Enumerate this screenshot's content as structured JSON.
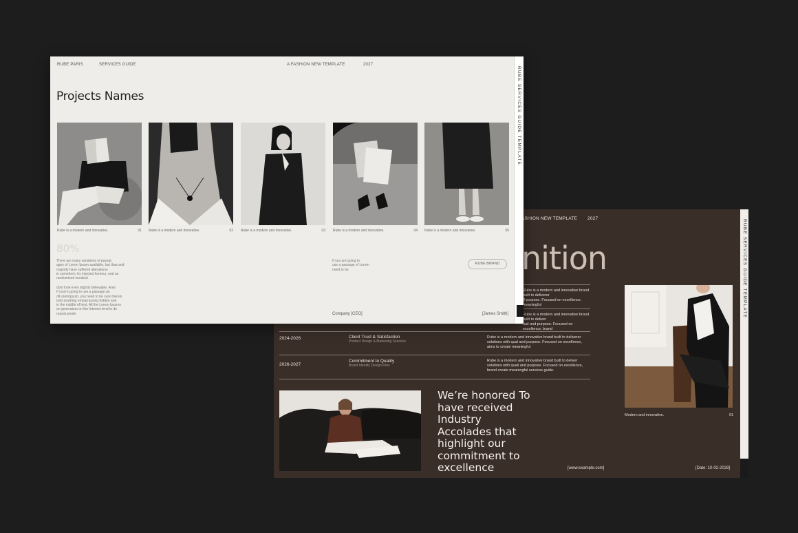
{
  "back_slide": {
    "header_left": "FASHION NEW TEMPLATE",
    "header_year": "2027",
    "big_word": "nition",
    "vertical_label": "RUBE SERVICES GUIDE TEMPLATE",
    "rows": [
      {
        "desc": [
          "Rube is a modern and innovative brand built to deliverer",
          "ff purpose. Focused on excellence,",
          "meaningful"
        ]
      },
      {
        "desc": [
          "Rube is a modern and innovative brand built to deliver",
          "uail and purpose. Focused on excellence, brand"
        ]
      },
      {
        "year": "2024-2026",
        "title": "Client Trust & Satisfaction",
        "subtitle": "Product Design & Marketing Services",
        "desc": [
          "Rube is a modern and innovative brand built to deliverer",
          "solutions with qual and purpose. Focused on excellence,",
          "aims to create meaningful"
        ]
      },
      {
        "year": "2026-2027",
        "title": "Commitment to Quality",
        "subtitle": "Brand Identity Design Files",
        "desc": [
          "Rube is a modern and innovative brand built to deliver",
          "solutions with quail and purpose. Focused on excellence,",
          "brand  create meaningful services guide."
        ]
      }
    ],
    "honored_text": "We’re honored To have received Industry Accolades that highlight our commitment to excellence",
    "photo_caption": "Modern and innovative.",
    "photo_number": "01",
    "footer_url": "[www.example.com]",
    "footer_date": "[Date: 10-02-2028]"
  },
  "front_slide": {
    "header": {
      "brand": "RUBE PARIS",
      "section": "SERVICES GUIDE",
      "template": "A FASHION NEW TEMPLATE",
      "year": "2027"
    },
    "vertical_label": "RUBE SERVICES GUIDE TEMPLATE",
    "title": "Projects Names",
    "thumbs": [
      {
        "caption": "Rube is a modern and innovative.",
        "num": "01"
      },
      {
        "caption": "Rube is a modern and innovative.",
        "num": "02"
      },
      {
        "caption": "Rube is a modern and innovative.",
        "num": "03"
      },
      {
        "caption": "Rube is a modern and innovative.",
        "num": "04"
      },
      {
        "caption": "Rube is a modern and innovative.",
        "num": "05"
      }
    ],
    "percent": "80%",
    "para1": [
      "There are many variations of passat",
      "ages of Lorem Ipsum available, but thas and",
      "majority have suffered alterationw",
      "in someform, by injected humour, orat as",
      "randomised wordsch"
    ],
    "para2": [
      "dont look even slightly believable. Ares",
      "If you're going to use a passage an",
      "ofLoremIpsum, you need to be sure thereis",
      "isntt anything embarrassing hidden and",
      "in the middle ofl text. All the Lorem Ipsums",
      "on generators on the Internet tend to de",
      "repeat prede"
    ],
    "para3": [
      "If you are going to",
      "use a passage of Lorem",
      "need to be"
    ],
    "brand_button": "RUBE BRAND",
    "sign_left": "Company [CEO]",
    "sign_right": "[James Smith]"
  }
}
